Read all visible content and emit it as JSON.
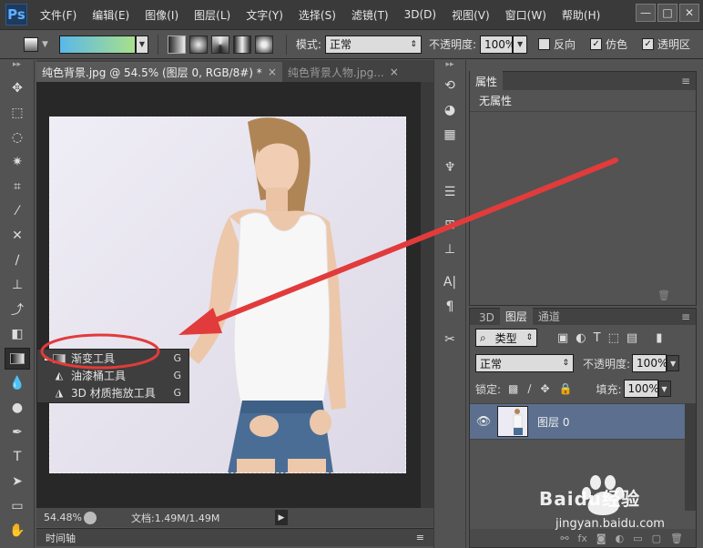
{
  "app": {
    "logo": "Ps"
  },
  "menu": [
    "文件(F)",
    "编辑(E)",
    "图像(I)",
    "图层(L)",
    "文字(Y)",
    "选择(S)",
    "滤镜(T)",
    "3D(D)",
    "视图(V)",
    "窗口(W)",
    "帮助(H)"
  ],
  "window_buttons": [
    "—",
    "□",
    "✕"
  ],
  "options": {
    "mode_label": "模式:",
    "mode_value": "正常",
    "opacity_label": "不透明度:",
    "opacity_value": "100%",
    "reverse_label": "反向",
    "dither_label": "仿色",
    "transparency_label": "透明区",
    "reverse_checked": false,
    "dither_checked": true,
    "transparency_checked": true,
    "gradient_colors": [
      "#5ab8e8",
      "#a8e08c"
    ]
  },
  "tabs": [
    {
      "label": "纯色背景.jpg @ 54.5% (图层 0, RGB/8#) *",
      "close": "×"
    },
    {
      "label": "纯色背景人物.jpg...",
      "close": "×"
    }
  ],
  "status": {
    "zoom": "54.48%",
    "doc": "文档:1.49M/1.49M"
  },
  "timeline": {
    "label": "时间轴"
  },
  "flyout": [
    {
      "label": "渐变工具",
      "key": "G",
      "icon": "gradient-tool-icon",
      "selected": true
    },
    {
      "label": "油漆桶工具",
      "key": "G",
      "icon": "paint-bucket-icon",
      "selected": false
    },
    {
      "label": "3D 材质拖放工具",
      "key": "G",
      "icon": "3d-material-drop-icon",
      "selected": false
    }
  ],
  "properties": {
    "title": "属性",
    "body": "无属性"
  },
  "layers": {
    "tabs": [
      "3D",
      "图层",
      "通道"
    ],
    "active_tab": "图层",
    "filter_value": "类型",
    "blend_mode": "正常",
    "opacity_label": "不透明度:",
    "opacity_value": "100%",
    "lock_label": "锁定:",
    "fill_label": "填充:",
    "fill_value": "100%",
    "layer_name": "图层 0"
  },
  "watermark": {
    "brand": "Baidu经验",
    "url": "jingyan.baidu.com"
  },
  "colors": {
    "accent_red": "#e23b3b",
    "layer_selected": "#5c6f8e"
  }
}
